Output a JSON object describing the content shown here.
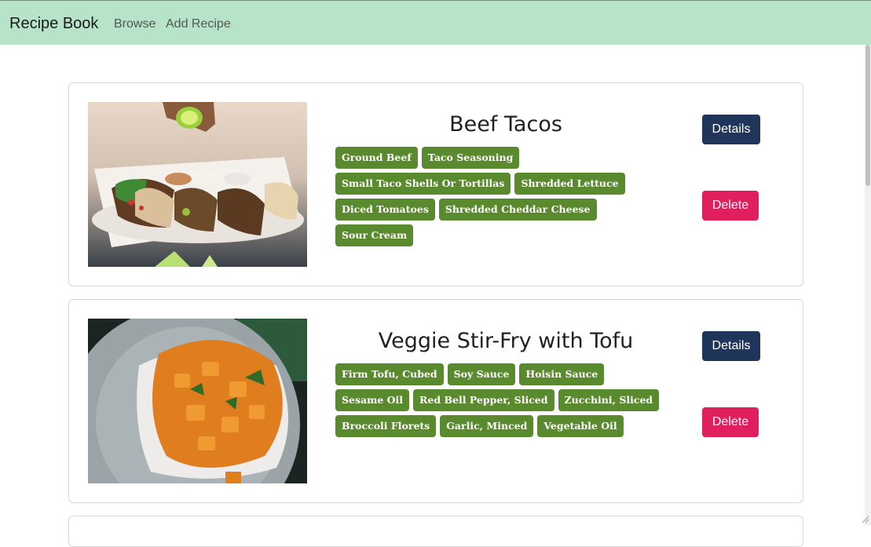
{
  "nav": {
    "brand": "Recipe Book",
    "links": [
      "Browse",
      "Add Recipe"
    ]
  },
  "colors": {
    "navbar": "#b7e3c8",
    "tag": "#5a8a2e",
    "details_button": "#1f3559",
    "delete_button": "#df1f5e"
  },
  "recipes": [
    {
      "title": "Beef Tacos",
      "ingredients": [
        "Ground Beef",
        "Taco Seasoning",
        "Small Taco Shells Or Tortillas",
        "Shredded Lettuce",
        "Diced Tomatoes",
        "Shredded Cheddar Cheese",
        "Sour Cream"
      ],
      "details_label": "Details",
      "delete_label": "Delete"
    },
    {
      "title": "Veggie Stir-Fry with Tofu",
      "ingredients": [
        "Firm Tofu, Cubed",
        "Soy Sauce",
        "Hoisin Sauce",
        "Sesame Oil",
        "Red Bell Pepper, Sliced",
        "Zucchini, Sliced",
        "Broccoli Florets",
        "Garlic, Minced",
        "Vegetable Oil"
      ],
      "details_label": "Details",
      "delete_label": "Delete"
    }
  ]
}
